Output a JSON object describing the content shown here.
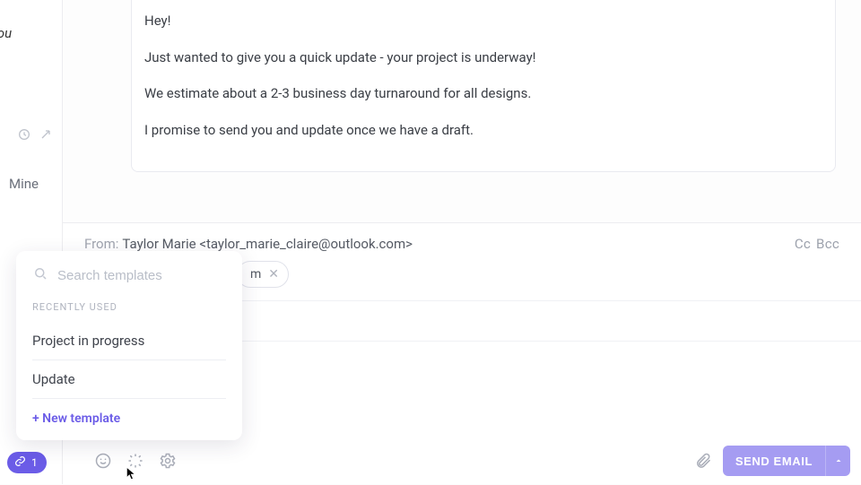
{
  "sidebar": {
    "you_label": "you",
    "mine_label": "Mine"
  },
  "email_body": {
    "p1": "Hey!",
    "p2": "Just wanted to give you a quick update - your project is underway!",
    "p3": "We estimate about a 2-3 business day turnaround for all designs.",
    "p4": "I promise to send you and update once we have a draft."
  },
  "compose": {
    "from_label": "From:",
    "from_value": "Taylor Marie <taylor_marie_claire@outlook.com>",
    "cc_label": "Cc",
    "bcc_label": "Bcc",
    "recipient_chip": "m",
    "send_label": "SEND EMAIL"
  },
  "templates_popover": {
    "search_placeholder": "Search templates",
    "section_heading": "RECENTLY USED",
    "items": [
      {
        "label": "Project in progress"
      },
      {
        "label": "Update"
      }
    ],
    "new_label": "+ New template"
  },
  "link_pill": {
    "count": "1"
  }
}
